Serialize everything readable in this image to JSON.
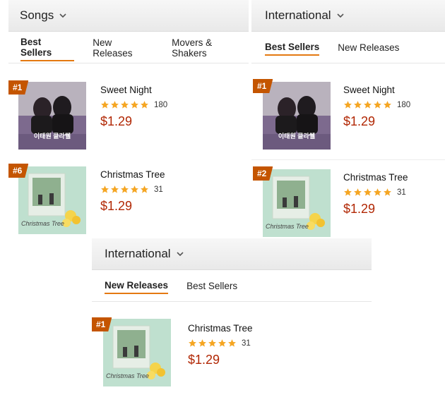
{
  "panels": [
    {
      "header": "Songs",
      "tabs": [
        "Best Sellers",
        "New Releases",
        "Movers & Shakers"
      ],
      "items": [
        {
          "rank": "#1",
          "title": "Sweet Night",
          "rating_count": "180",
          "price": "$1.29",
          "cover": "itaewon-class"
        },
        {
          "rank": "#6",
          "title": "Christmas Tree",
          "rating_count": "31",
          "price": "$1.29",
          "cover": "christmas-tree"
        }
      ]
    },
    {
      "header": "International",
      "tabs": [
        "Best Sellers",
        "New Releases"
      ],
      "items": [
        {
          "rank": "#1",
          "title": "Sweet Night",
          "rating_count": "180",
          "price": "$1.29",
          "cover": "itaewon-class"
        },
        {
          "rank": "#2",
          "title": "Christmas Tree",
          "rating_count": "31",
          "price": "$1.29",
          "cover": "christmas-tree"
        }
      ]
    },
    {
      "header": "International",
      "tabs": [
        "New Releases",
        "Best Sellers"
      ],
      "items": [
        {
          "rank": "#1",
          "title": "Christmas Tree",
          "rating_count": "31",
          "price": "$1.29",
          "cover": "christmas-tree"
        }
      ]
    }
  ],
  "cover_text": {
    "itaewon-class": "이태원 클라쒤",
    "christmas-tree": "Christmas Tree"
  },
  "colors": {
    "accent": "#e47911",
    "rank_badge": "#c45500",
    "price": "#b12704",
    "star": "#f5a623"
  }
}
